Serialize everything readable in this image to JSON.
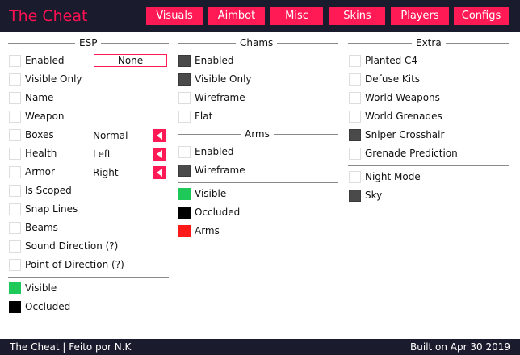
{
  "header": {
    "title": "The Cheat",
    "tabs": [
      "Visuals",
      "Aimbot",
      "Misc",
      "Skins",
      "Players",
      "Configs"
    ]
  },
  "esp": {
    "heading": "ESP",
    "items": [
      "Enabled",
      "Visible Only",
      "Name",
      "Weapon",
      "Boxes",
      "Health",
      "Armor",
      "Is Scoped",
      "Snap Lines",
      "Beams",
      "Sound Direction (?)",
      "Point of Direction (?)"
    ],
    "enabled_value": "None",
    "boxes_value": "Normal",
    "health_value": "Left",
    "armor_value": "Right",
    "colors": [
      {
        "label": "Visible",
        "color": "#1ec95a"
      },
      {
        "label": "Occluded",
        "color": "#000000"
      }
    ]
  },
  "chams": {
    "heading": "Chams",
    "items": [
      {
        "label": "Enabled",
        "checked": true
      },
      {
        "label": "Visible Only",
        "checked": true
      },
      {
        "label": "Wireframe",
        "checked": false
      },
      {
        "label": "Flat",
        "checked": false
      }
    ],
    "arms_heading": "Arms",
    "arms_items": [
      {
        "label": "Enabled",
        "checked": false
      },
      {
        "label": "Wireframe",
        "checked": true
      }
    ],
    "colors": [
      {
        "label": "Visible",
        "color": "#1ec95a"
      },
      {
        "label": "Occluded",
        "color": "#000000"
      },
      {
        "label": "Arms",
        "color": "#ff1a1a"
      }
    ]
  },
  "extra": {
    "heading": "Extra",
    "items": [
      {
        "label": "Planted C4",
        "checked": false
      },
      {
        "label": "Defuse Kits",
        "checked": false
      },
      {
        "label": "World Weapons",
        "checked": false
      },
      {
        "label": "World Grenades",
        "checked": false
      },
      {
        "label": "Sniper Crosshair",
        "checked": true
      },
      {
        "label": "Grenade Prediction",
        "checked": false
      }
    ],
    "items2": [
      {
        "label": "Night Mode",
        "checked": false
      },
      {
        "label": "Sky",
        "checked": true
      }
    ]
  },
  "footer": {
    "left": "The Cheat | Feito por N.K",
    "right": "Built on Apr 30 2019"
  }
}
